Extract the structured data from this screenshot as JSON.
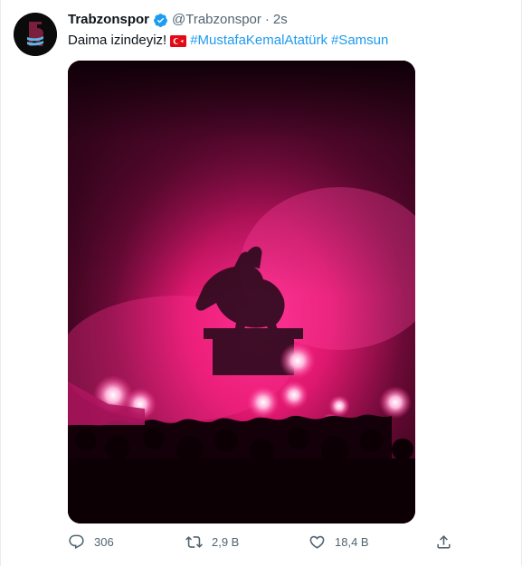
{
  "tweet": {
    "author_name": "Trabzonspor",
    "handle": "@Trabzonspor",
    "separator": "·",
    "time": "2s",
    "text_prefix": "Daima izindeyiz!",
    "hashtags": [
      "#MustafaKemalAtatürk",
      "#Samsun"
    ]
  },
  "actions": {
    "replies": "306",
    "retweets": "2,9 B",
    "likes": "18,4 B"
  },
  "icons": {
    "verified": "verified-badge-icon",
    "flag": "turkey-flag-emoji",
    "reply": "reply-icon",
    "retweet": "retweet-icon",
    "like": "heart-icon",
    "share": "share-icon"
  },
  "colors": {
    "accent": "#1d9bf0",
    "secondary_text": "#536471",
    "flare_pink": "#ff1f8e"
  }
}
